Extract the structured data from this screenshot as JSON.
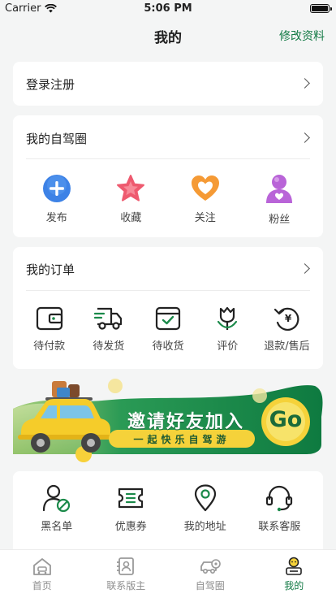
{
  "status": {
    "carrier": "Carrier",
    "time": "5:06 PM"
  },
  "nav": {
    "title": "我的",
    "action": "修改资料"
  },
  "login": {
    "label": "登录注册"
  },
  "circle": {
    "title": "我的自驾圈",
    "items": [
      {
        "label": "发布",
        "icon": "plus-circle-icon"
      },
      {
        "label": "收藏",
        "icon": "star-icon"
      },
      {
        "label": "关注",
        "icon": "heart-icon"
      },
      {
        "label": "粉丝",
        "icon": "user-icon"
      }
    ]
  },
  "orders": {
    "title": "我的订单",
    "items": [
      {
        "label": "待付款",
        "icon": "wallet-icon"
      },
      {
        "label": "待发货",
        "icon": "truck-icon"
      },
      {
        "label": "待收货",
        "icon": "box-check-icon"
      },
      {
        "label": "评价",
        "icon": "tulip-icon"
      },
      {
        "label": "退款/售后",
        "icon": "refund-icon"
      }
    ]
  },
  "banner": {
    "headline": "邀请好友加入",
    "sub": "一起快乐自驾游",
    "go": "Go"
  },
  "services": {
    "items": [
      {
        "label": "黑名单",
        "icon": "blacklist-icon"
      },
      {
        "label": "优惠券",
        "icon": "coupon-icon"
      },
      {
        "label": "我的地址",
        "icon": "location-icon"
      },
      {
        "label": "联系客服",
        "icon": "headset-icon"
      }
    ]
  },
  "tabbar": {
    "items": [
      {
        "label": "首页",
        "icon": "home-icon"
      },
      {
        "label": "联系版主",
        "icon": "contact-icon"
      },
      {
        "label": "自驾圈",
        "icon": "car-circle-icon"
      },
      {
        "label": "我的",
        "icon": "profile-icon"
      }
    ],
    "active_index": 3
  },
  "colors": {
    "accent": "#137a45",
    "banner_green": "#1b8a4a",
    "banner_yellow": "#f5d23a"
  }
}
